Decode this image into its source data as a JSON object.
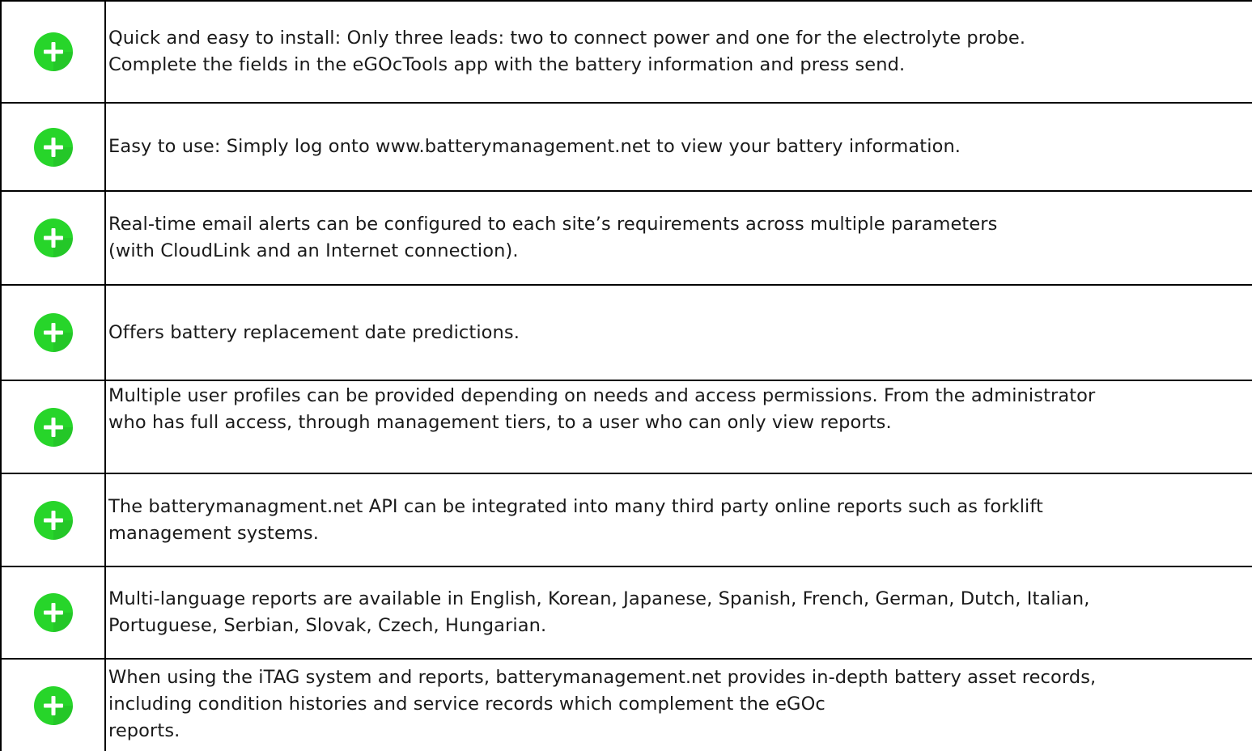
{
  "colors": {
    "icon_green": "#27d52a",
    "icon_shadow": "#1fae24",
    "border": "#000000",
    "text": "#1a1a1a"
  },
  "icon": "plus-circle-icon",
  "features": [
    {
      "text": "Quick and easy to install: Only three leads: two to connect power and one for the electrolyte probe.\nComplete the fields in the eGOcTools app with the battery information and press send."
    },
    {
      "text": "Easy to use: Simply log onto www.batterymanagement.net to view your battery information."
    },
    {
      "text": "Real-time email alerts can be configured to each site’s requirements across multiple parameters\n(with CloudLink and an Internet connection)."
    },
    {
      "text": "Offers battery replacement date predictions."
    },
    {
      "text": "Multiple user profiles can be provided depending on needs and access permissions. From the administrator\nwho has full access, through management tiers, to a user who can only view reports."
    },
    {
      "text": "The batterymanagment.net API can be integrated into many third party online reports such as forklift\nmanagement systems."
    },
    {
      "text": "Multi-language reports are available in English, Korean, Japanese, Spanish, French, German, Dutch, Italian,\nPortuguese, Serbian, Slovak, Czech, Hungarian."
    },
    {
      "text": "When using the iTAG system and reports, batterymanagement.net provides in-depth battery asset records,\nincluding condition histories and service records which complement the eGOc\nreports."
    }
  ]
}
